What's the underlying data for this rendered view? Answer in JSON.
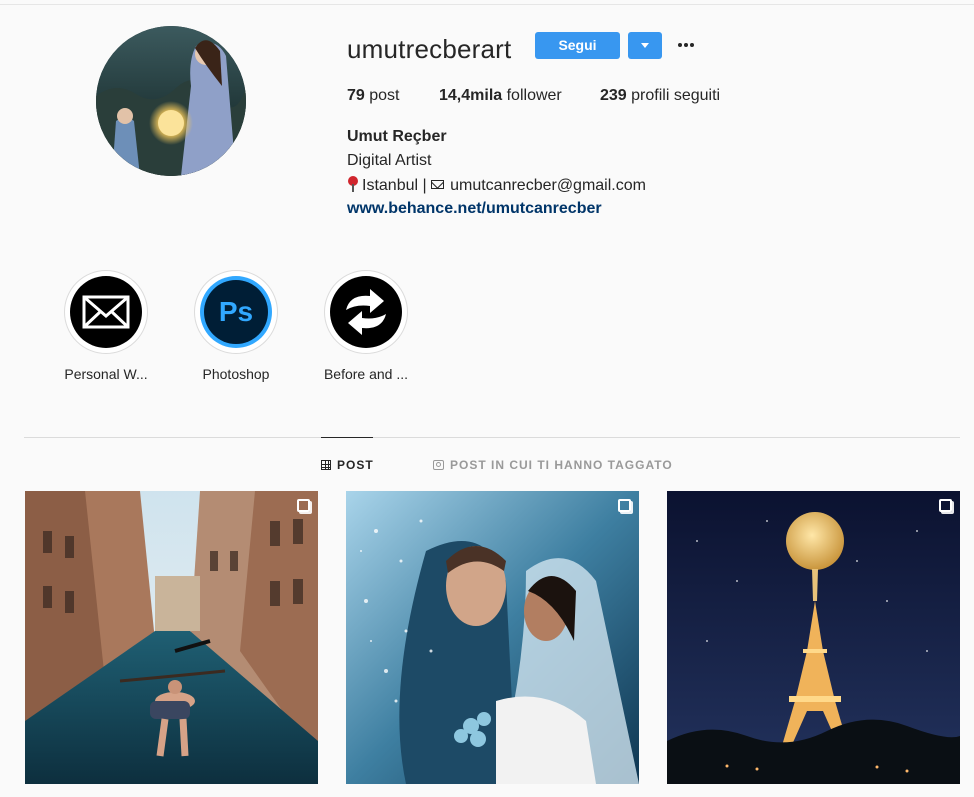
{
  "profile": {
    "username": "umutrecberart",
    "follow_label": "Segui",
    "more_label": "...",
    "stats": {
      "posts_count": "79",
      "posts_label": "post",
      "followers_count": "14,4mila",
      "followers_label": "follower",
      "following_count": "239",
      "following_label": "profili seguiti"
    },
    "full_name": "Umut Reçber",
    "bio_line1": "Digital Artist",
    "bio_location": "Istanbul |",
    "bio_email": "umutcanrecber@gmail.com",
    "website": "www.behance.net/umutcanrecber"
  },
  "highlights": [
    {
      "label": "Personal W...",
      "icon": "envelope-icon"
    },
    {
      "label": "Photoshop",
      "icon": "photoshop-icon",
      "icon_text": "Ps"
    },
    {
      "label": "Before and ...",
      "icon": "swap-arrows-icon"
    }
  ],
  "tabs": {
    "posts": "POST",
    "tagged": "POST IN CUI TI HANNO TAGGATO"
  },
  "posts": [
    {
      "subject": "venice-canal-floating-man",
      "multiple": true
    },
    {
      "subject": "wedding-couple-dispersion",
      "multiple": true
    },
    {
      "subject": "eiffel-tower-moon-balloon",
      "multiple": true
    }
  ],
  "colors": {
    "accent": "#3897f0",
    "link": "#003569",
    "text": "#262626",
    "muted": "#999999",
    "background": "#fafafa"
  }
}
